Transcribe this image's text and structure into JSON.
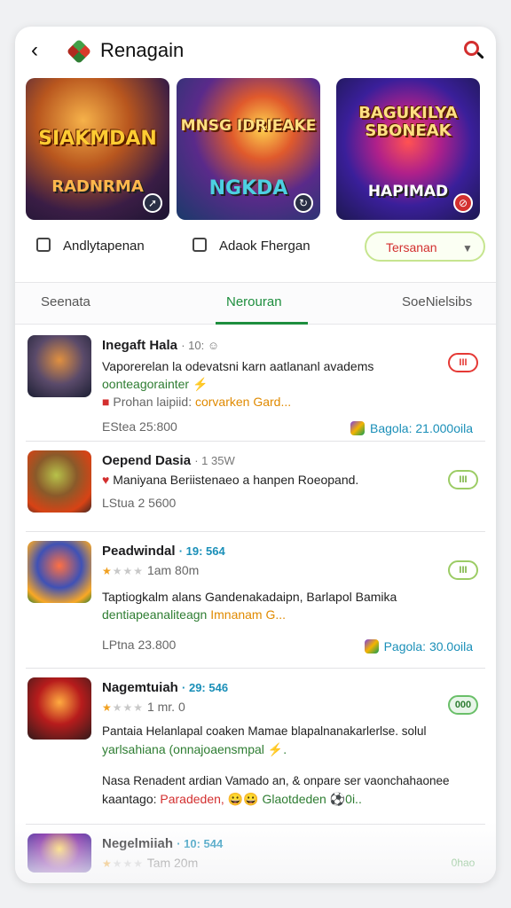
{
  "header": {
    "title": "Renagain",
    "back_icon": "back-arrow-icon",
    "logo_icon": "app-logo-icon",
    "search_icon": "search-icon"
  },
  "banners": [
    {
      "title": "SIAKMDAN",
      "subtitle": "RADNRMA",
      "icon": "compass-icon"
    },
    {
      "title": "MNSG IDRIEAKE",
      "subtitle": "NGKDA",
      "icon": "swirl-icon"
    },
    {
      "title": "BAGUKILYA SBONEAK",
      "subtitle": "HAPIMAD",
      "icon": "no-entry-icon"
    }
  ],
  "actions": {
    "action1_label": "Andlytapenan",
    "action2_label": "Adaok Fhergan",
    "dropdown_label": "Tersanan"
  },
  "tabs": [
    "Seenata",
    "Nerouran",
    "SoeNielsibs"
  ],
  "active_tab": "Nerouran",
  "items": [
    {
      "name": "Inegaft Hala",
      "meta": "· 10: ☺",
      "line1": "Vaporerelan la odevatsni karn aatlananl avadems",
      "line2": "oonteagorainter ⚡",
      "line3_prefix": "Prohan laipiid:",
      "line3_highlight": "corvarken Gard...",
      "footer": "EStea 25:800",
      "count": "Bagola: 21.000oila",
      "pill": "III"
    },
    {
      "name": "Oepend Dasia",
      "meta": "· 1 35W",
      "line1": "Maniyana Beriistenaeo a hanpen Roeopand.",
      "footer": "LStua 2 5600",
      "pill": "III"
    },
    {
      "name": "Peadwindal",
      "meta": "· 19: 564",
      "rating": "1am 80m",
      "line1": "Taptiogkalm alans Gandenakadaipn, Barlapol Bamika",
      "line2_prefix": "dentiapeanaliteagn",
      "line2_highlight": "Imnanam G...",
      "footer": "LPtna 23.800",
      "count": "Pagola: 30.0oila",
      "pill": "III"
    },
    {
      "name": "Nagemtuiah",
      "meta": "· 29: 546",
      "rating": "1 mr. 0",
      "line1": "Pantaia Helanlapal coaken Mamae blapalnanakarlerlse. solul",
      "line2": "yarlsahiana (onnajoaensmpal ⚡.",
      "line3": "Nasa Renadent ardian Vamado an, & onpare ser vaonchahaonee",
      "line4_prefix": "kaantago:",
      "line4_highlight": "Paradeden,",
      "line4_suffix": "😀😀 Glaotdeden ⚽0i..",
      "pill": "000"
    },
    {
      "name": "Negelmiiah",
      "meta": "· 10: 544",
      "rating": "Tam 20m",
      "pill": "0hao"
    }
  ]
}
